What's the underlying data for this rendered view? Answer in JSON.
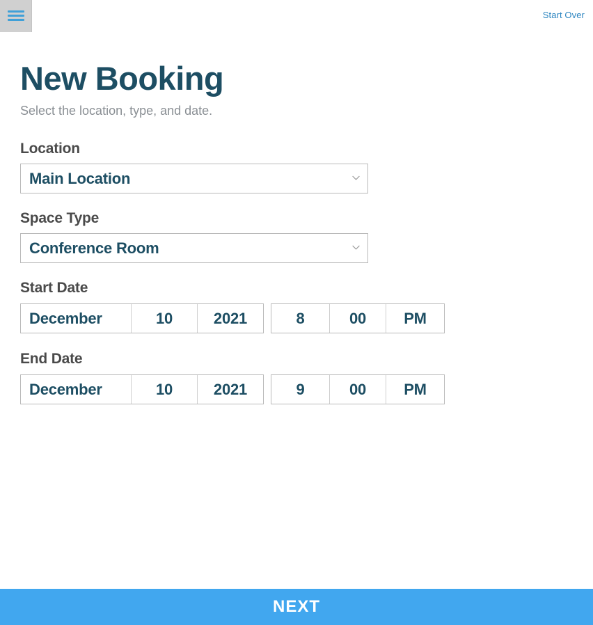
{
  "topbar": {
    "menu_icon": "hamburger-menu-icon",
    "start_over_label": "Start Over",
    "link_color": "#2e86c1",
    "menu_line_color": "#3fa0d8"
  },
  "header": {
    "title": "New Booking",
    "subtitle": "Select the location, type, and date.",
    "title_color": "#1d4e63",
    "subtitle_color": "#8a8f94"
  },
  "form": {
    "location": {
      "label": "Location",
      "value": "Main Location",
      "chevron_icon": "chevron-down-icon"
    },
    "space_type": {
      "label": "Space Type",
      "value": "Conference Room",
      "chevron_icon": "chevron-down-icon"
    },
    "start_date": {
      "label": "Start Date",
      "month": "December",
      "day": "10",
      "year": "2021",
      "hour": "8",
      "minute": "00",
      "meridiem": "PM"
    },
    "end_date": {
      "label": "End Date",
      "month": "December",
      "day": "10",
      "year": "2021",
      "hour": "9",
      "minute": "00",
      "meridiem": "PM"
    }
  },
  "footer": {
    "next_label": "NEXT",
    "bar_color": "#41a7ef"
  }
}
